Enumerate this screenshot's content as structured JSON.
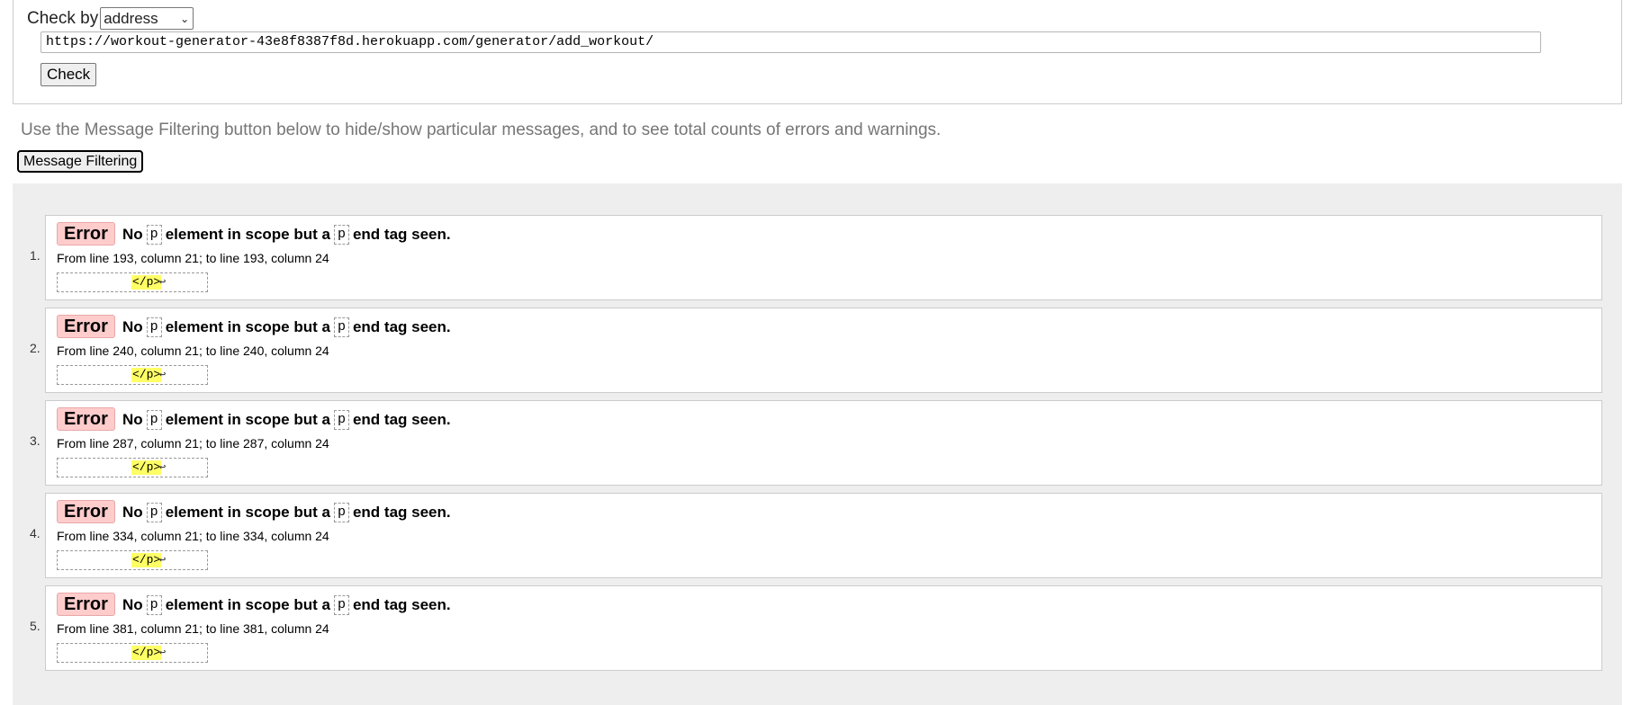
{
  "checker": {
    "label": "Check by",
    "select_value": "address",
    "url_value": "https://workout-generator-43e8f8387f8d.herokuapp.com/generator/add_workout/",
    "check_label": "Check"
  },
  "filter": {
    "hint": "Use the Message Filtering button below to hide/show particular messages, and to see total counts of errors and warnings.",
    "button_label": "Message Filtering"
  },
  "messages": [
    {
      "num": "1.",
      "type": "Error",
      "pre": "No",
      "tok1": "p",
      "mid": "element in scope but a",
      "tok2": "p",
      "post": "end tag seen.",
      "location": "From line 193, column 21; to line 193, column 24",
      "extract": "</p>",
      "ret": "↩"
    },
    {
      "num": "2.",
      "type": "Error",
      "pre": "No",
      "tok1": "p",
      "mid": "element in scope but a",
      "tok2": "p",
      "post": "end tag seen.",
      "location": "From line 240, column 21; to line 240, column 24",
      "extract": "</p>",
      "ret": "↩"
    },
    {
      "num": "3.",
      "type": "Error",
      "pre": "No",
      "tok1": "p",
      "mid": "element in scope but a",
      "tok2": "p",
      "post": "end tag seen.",
      "location": "From line 287, column 21; to line 287, column 24",
      "extract": "</p>",
      "ret": "↩"
    },
    {
      "num": "4.",
      "type": "Error",
      "pre": "No",
      "tok1": "p",
      "mid": "element in scope but a",
      "tok2": "p",
      "post": "end tag seen.",
      "location": "From line 334, column 21; to line 334, column 24",
      "extract": "</p>",
      "ret": "↩"
    },
    {
      "num": "5.",
      "type": "Error",
      "pre": "No",
      "tok1": "p",
      "mid": "element in scope but a",
      "tok2": "p",
      "post": "end tag seen.",
      "location": "From line 381, column 21; to line 381, column 24",
      "extract": "</p>",
      "ret": "↩"
    }
  ],
  "colors": {
    "error_badge_bg": "#ffcccc",
    "extract_highlight": "#ffff66",
    "panel_bg": "#eeeeee"
  }
}
